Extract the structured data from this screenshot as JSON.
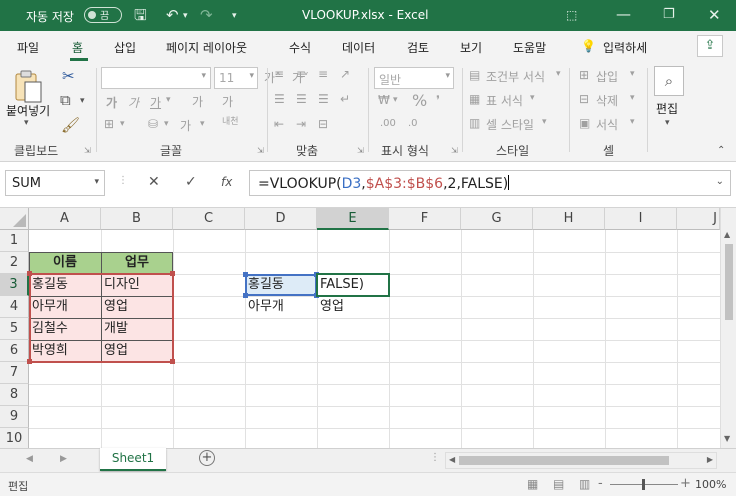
{
  "titlebar": {
    "autosave_label": "자동 저장",
    "autosave_state": "끔",
    "file_title": "VLOOKUP.xlsx  -  Excel"
  },
  "tabs": [
    "파일",
    "홈",
    "삽입",
    "페이지 레이아웃",
    "수식",
    "데이터",
    "검토",
    "보기",
    "도움말"
  ],
  "active_tab": "홈",
  "tell_me": "입력하세",
  "ribbon": {
    "clipboard": {
      "paste": "붙여넣기",
      "label": "클립보드"
    },
    "font": {
      "size": "11",
      "bold": "가",
      "italic": "가",
      "underline": "가",
      "grow": "가˄",
      "shrink": "가˅",
      "phonetic": "내천",
      "label": "글꼴"
    },
    "alignment": {
      "label": "맞춤"
    },
    "number": {
      "format": "일반",
      "percent": "%",
      "label": "표시 형식"
    },
    "styles": {
      "conditional": "조건부 서식",
      "table": "표 서식",
      "cell_styles": "셀 스타일",
      "label": "스타일"
    },
    "cells": {
      "insert": "삽입",
      "delete": "삭제",
      "format": "서식",
      "label": "셀"
    },
    "editing": {
      "label": "편집"
    }
  },
  "formula_bar": {
    "name_box": "SUM",
    "cancel": "✕",
    "enter": "✓",
    "fx": "fx",
    "formula_prefix": "=VLOOKUP(",
    "ref_d3": "D3",
    "comma1": ",",
    "ref_range": "$A$3:$B$6",
    "formula_suffix": ",2,FALSE)"
  },
  "columns": [
    "A",
    "B",
    "C",
    "D",
    "E",
    "F",
    "G",
    "H",
    "I",
    "J"
  ],
  "rows": [
    "1",
    "2",
    "3",
    "4",
    "5",
    "6",
    "7",
    "8",
    "9",
    "10"
  ],
  "cells": {
    "A2": "이름",
    "B2": "업무",
    "A3": "홍길동",
    "B3": "디자인",
    "A4": "아무개",
    "B4": "영업",
    "A5": "김철수",
    "B5": "개발",
    "A6": "박영희",
    "B6": "영업",
    "D3": "홍길동",
    "E3": "FALSE)",
    "D4": "아무개",
    "E4": "영업"
  },
  "sheets": [
    "Sheet1"
  ],
  "status": {
    "mode": "편집",
    "zoom": "100%",
    "minus": "-",
    "plus": "+"
  },
  "colors": {
    "brand": "#217346",
    "header_fill": "#a9d18e",
    "range_fill": "#fce4e4",
    "range_border": "#c0504d",
    "ref_fill": "#ddebf7",
    "ref_border": "#4472c4"
  }
}
